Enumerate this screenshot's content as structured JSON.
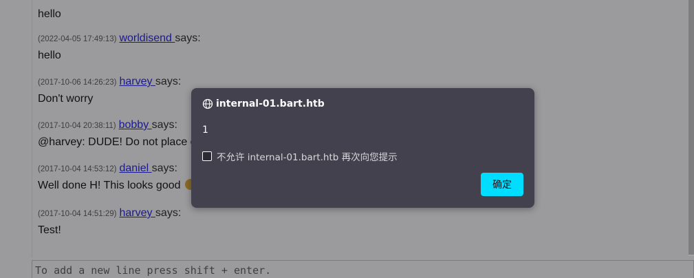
{
  "chat": {
    "messages": [
      {
        "timestamp": "",
        "user": "",
        "says": "",
        "text": "hello"
      },
      {
        "timestamp": "(2022-04-05 17:49:13)",
        "user": "worldisend ",
        "says": "says:",
        "text": "hello"
      },
      {
        "timestamp": "(2017-10-06 14:26:23)",
        "user": "harvey ",
        "says": "says:",
        "text": "Don't worry"
      },
      {
        "timestamp": "(2017-10-04 20:38:11)",
        "user": "bobby ",
        "says": "says:",
        "text": "@harvey: DUDE! Do not place c"
      },
      {
        "timestamp": "(2017-10-04 14:53:12)",
        "user": "daniel ",
        "says": "says:",
        "text": "Well done H! This looks good"
      },
      {
        "timestamp": "(2017-10-04 14:51:29)",
        "user": "harvey ",
        "says": "says:",
        "text": "Test!"
      }
    ]
  },
  "input": {
    "placeholder": "To add a new line press shift + enter."
  },
  "dialog": {
    "origin": "internal-01.bart.htb",
    "message": "1",
    "checkbox_label": "不允许 internal-01.bart.htb 再次向您提示",
    "ok_label": "确定"
  },
  "colors": {
    "dialog_bg": "#42414d",
    "ok_button": "#00ddff",
    "username_link": "#1a1a8c"
  }
}
